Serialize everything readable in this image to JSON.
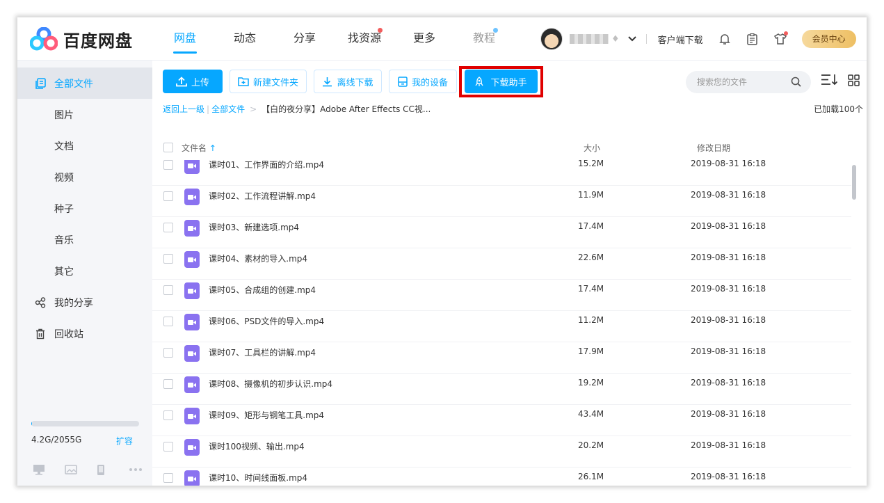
{
  "app": {
    "logo_text": "百度网盘"
  },
  "nav": {
    "items": [
      {
        "label": "网盘",
        "state": "active"
      },
      {
        "label": "动态",
        "state": ""
      },
      {
        "label": "分享",
        "state": ""
      },
      {
        "label": "找资源",
        "state": "red-dot"
      },
      {
        "label": "更多",
        "state": ""
      },
      {
        "label": "教程",
        "state": "blue-dot"
      }
    ]
  },
  "header": {
    "client_download": "客户端下载",
    "vip_label": "会员中心",
    "icons": [
      "bell-icon",
      "clipboard-icon",
      "shirt-icon"
    ]
  },
  "sidebar": {
    "items": [
      {
        "label": "全部文件",
        "icon": "files-icon",
        "active": true
      },
      {
        "label": "图片"
      },
      {
        "label": "文档"
      },
      {
        "label": "视频"
      },
      {
        "label": "种子"
      },
      {
        "label": "音乐"
      },
      {
        "label": "其它"
      },
      {
        "label": "我的分享",
        "icon": "share-icon"
      },
      {
        "label": "回收站",
        "icon": "trash-icon"
      }
    ],
    "quota_text": "4.2G/2055G",
    "quota_fraction": 0.002,
    "expand_label": "扩容"
  },
  "toolbar": {
    "upload": "上传",
    "new_folder": "新建文件夹",
    "offline_download": "离线下载",
    "my_devices": "我的设备",
    "download_helper": "下载助手"
  },
  "search": {
    "placeholder": "搜索您的文件"
  },
  "breadcrumb": {
    "back": "返回上一级",
    "all_files": "全部文件",
    "current": "【白的夜分享】Adobe After Effects CC视..."
  },
  "loaded_count": "已加载100个",
  "table": {
    "columns": {
      "name": "文件名",
      "size": "大小",
      "date": "修改日期"
    },
    "rows": [
      {
        "name": "课时01、工作界面的介绍.mp4",
        "size": "15.2M",
        "date": "2019-08-31 16:18"
      },
      {
        "name": "课时02、工作流程讲解.mp4",
        "size": "11.9M",
        "date": "2019-08-31 16:18"
      },
      {
        "name": "课时03、新建选项.mp4",
        "size": "17.4M",
        "date": "2019-08-31 16:18"
      },
      {
        "name": "课时04、素材的导入.mp4",
        "size": "22.6M",
        "date": "2019-08-31 16:18"
      },
      {
        "name": "课时05、合成组的创建.mp4",
        "size": "17.4M",
        "date": "2019-08-31 16:18"
      },
      {
        "name": "课时06、PSD文件的导入.mp4",
        "size": "11.2M",
        "date": "2019-08-31 16:18"
      },
      {
        "name": "课时07、工具栏的讲解.mp4",
        "size": "17.9M",
        "date": "2019-08-31 16:18"
      },
      {
        "name": "课时08、摄像机的初步认识.mp4",
        "size": "19.2M",
        "date": "2019-08-31 16:18"
      },
      {
        "name": "课时09、矩形与钢笔工具.mp4",
        "size": "43.4M",
        "date": "2019-08-31 16:18"
      },
      {
        "name": "课时100视频、输出.mp4",
        "size": "20.2M",
        "date": "2019-08-31 16:18"
      },
      {
        "name": "课时10、时间线面板.mp4",
        "size": "26.1M",
        "date": "2019-08-31 16:18"
      }
    ]
  },
  "colors": {
    "accent": "#06a7ff",
    "video_icon": "#8a72f0",
    "highlight": "#e00000"
  }
}
